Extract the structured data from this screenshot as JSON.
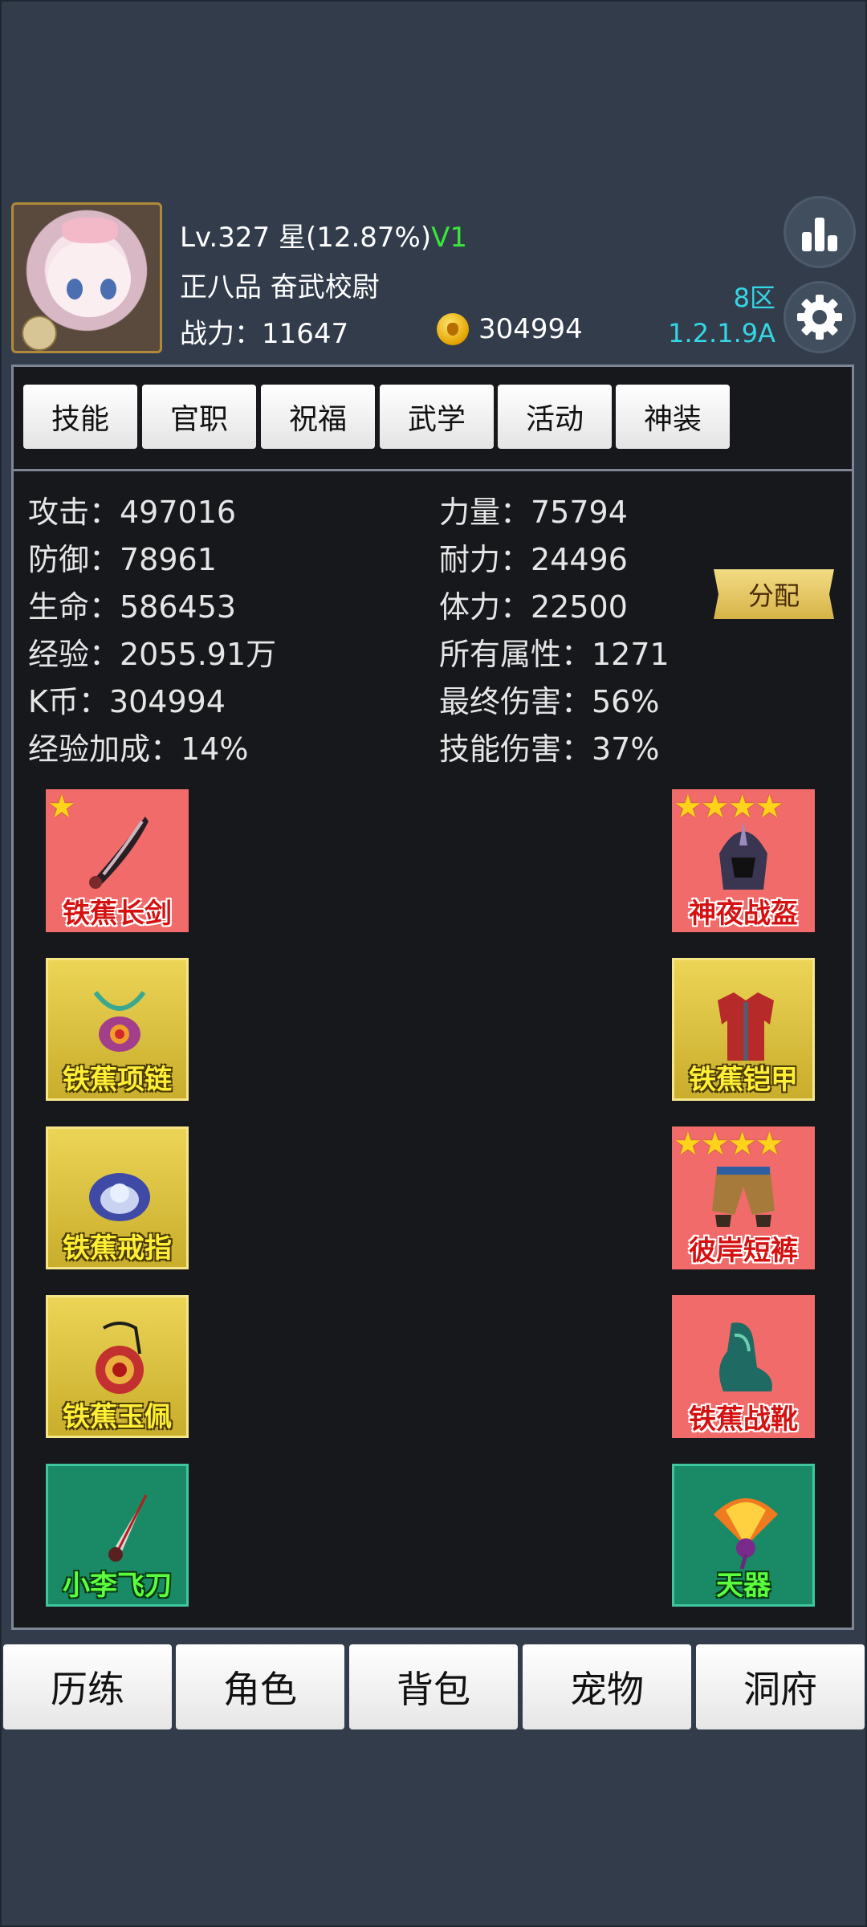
{
  "header": {
    "level": "Lv.327",
    "star": "星(12.87%)",
    "vip": "V1",
    "rank": "正八品 奋武校尉",
    "power": "战力：11647",
    "gold": "304994",
    "zone": "8区",
    "version": "1.2.1.9A"
  },
  "tabs": [
    "技能",
    "官职",
    "祝福",
    "武学",
    "活动",
    "神装"
  ],
  "attributes": {
    "attack": "攻击：497016",
    "defense": "防御：78961",
    "life": "生命：586453",
    "exp": "经验：2055.91万",
    "kcoin": "K币：304994",
    "exp_bonus": "经验加成：14%",
    "strength": "力量：75794",
    "endurance": "耐力：24496",
    "stamina": "体力：22500",
    "all_attr": "所有属性：1271",
    "final_damage": "最终伤害：56%",
    "skill_damage": "技能伤害：37%"
  },
  "allocate_label": "分配",
  "equipment": {
    "weapon": {
      "name": "铁蕉长剑",
      "stars": "★",
      "quality": "red"
    },
    "necklace": {
      "name": "铁蕉项链",
      "quality": "gold"
    },
    "ring": {
      "name": "铁蕉戒指",
      "quality": "gold"
    },
    "pendant": {
      "name": "铁蕉玉佩",
      "quality": "gold"
    },
    "dagger": {
      "name": "小李飞刀",
      "quality": "teal"
    },
    "helmet": {
      "name": "神夜战盔",
      "stars": "★★★★",
      "quality": "red"
    },
    "armor": {
      "name": "铁蕉铠甲",
      "quality": "gold"
    },
    "pants": {
      "name": "彼岸短裤",
      "stars": "★★★★",
      "quality": "red"
    },
    "boots": {
      "name": "铁蕉战靴",
      "quality": "red"
    },
    "artifact": {
      "name": "天器",
      "quality": "teal"
    }
  },
  "bottom_nav": [
    "历练",
    "角色",
    "背包",
    "宠物",
    "洞府"
  ],
  "colors": {
    "background": "#323c4b",
    "panel": "#17181c",
    "accent_cyan": "#35d6e6",
    "vip_green": "#39e639"
  }
}
